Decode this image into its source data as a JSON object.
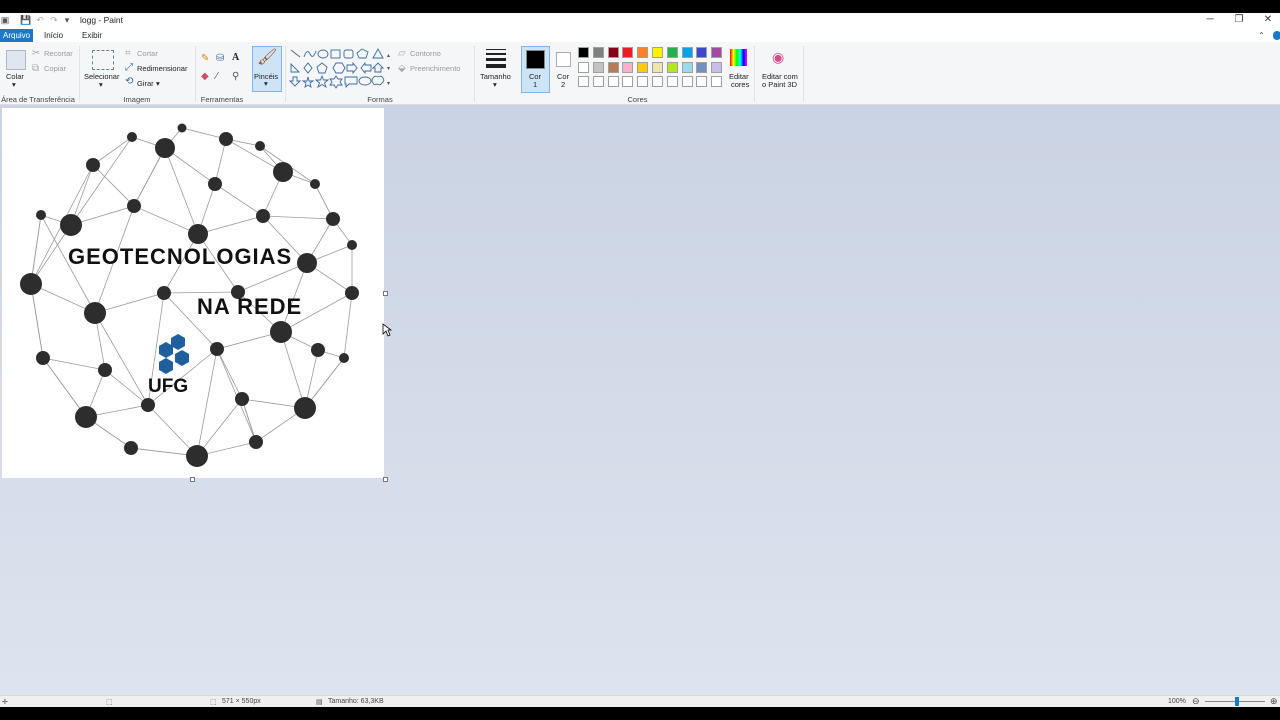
{
  "window": {
    "title": "logg - Paint"
  },
  "tabs": [
    "Arquivo",
    "Início",
    "Exibir"
  ],
  "clipboard": {
    "paste": "Colar",
    "cut": "Recortar",
    "copy": "Copiar",
    "group": "Área de Transferência"
  },
  "image": {
    "select": "Selecionar",
    "resize": "Redimensionar",
    "rotate": "Girar",
    "group": "Imagem"
  },
  "tools": {
    "group": "Ferramentas",
    "brushes": "Pincéis"
  },
  "shapes": {
    "outline": "Contorno",
    "fill": "Preenchimento",
    "group": "Formas"
  },
  "size": {
    "label": "Tamanho"
  },
  "color1": {
    "line1": "Cor",
    "line2": "1"
  },
  "color2": {
    "line1": "Cor",
    "line2": "2"
  },
  "colors": {
    "group": "Cores",
    "edit_line1": "Editar",
    "edit_line2": "cores",
    "paint3d_line1": "Editar com",
    "paint3d_line2": "o Paint 3D",
    "palette_row1": [
      "#000000",
      "#7f7f7f",
      "#880015",
      "#ed1c24",
      "#ff7f27",
      "#fff200",
      "#22b14c",
      "#00a2e8",
      "#3f48cc",
      "#a349a4"
    ],
    "palette_row2": [
      "#ffffff",
      "#c3c3c3",
      "#b97a57",
      "#ffaec9",
      "#ffc90e",
      "#efe4b0",
      "#b5e61d",
      "#99d9ea",
      "#7092be",
      "#c8bfe7"
    ],
    "palette_row3": [
      "#ffffff",
      "#ffffff",
      "#ffffff",
      "#ffffff",
      "#ffffff",
      "#ffffff",
      "#ffffff",
      "#ffffff",
      "#ffffff",
      "#ffffff"
    ]
  },
  "canvas_text": {
    "line1": "GEOTECNOLOGIAS",
    "line2": "NA REDE",
    "logo": "UFG"
  },
  "status": {
    "dimensions": "571 × 550px",
    "file_size": "Tamanho: 63,3KB",
    "zoom": "100%"
  }
}
